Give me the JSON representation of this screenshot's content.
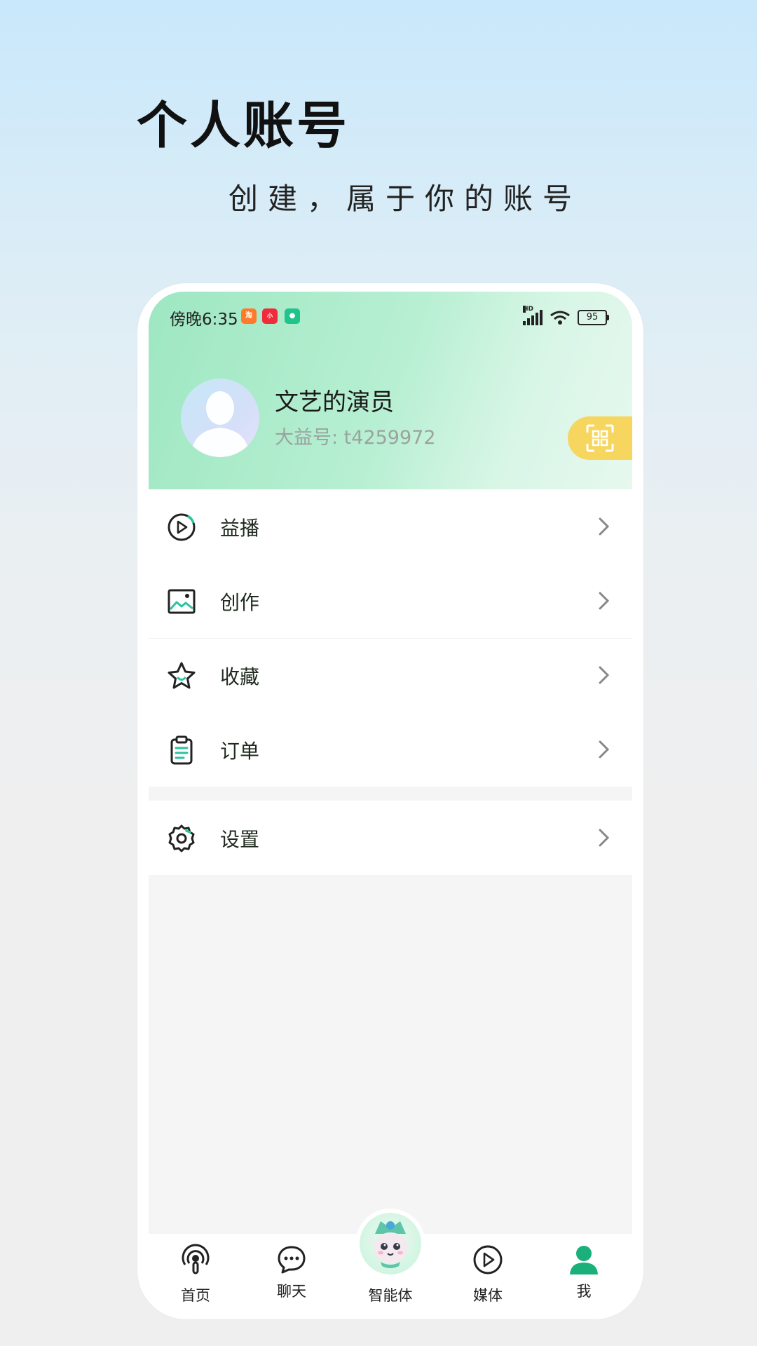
{
  "promo": {
    "title": "个人账号",
    "subtitle": "创建，属于你的账号"
  },
  "status_bar": {
    "time": "傍晚6:35",
    "network": "HD",
    "battery": "95"
  },
  "profile": {
    "name": "文艺的演员",
    "id_text": "大益号: t4259972"
  },
  "menu": {
    "items": [
      {
        "label": "益播",
        "icon": "play-circle-icon"
      },
      {
        "label": "创作",
        "icon": "image-icon"
      },
      {
        "label": "收藏",
        "icon": "star-icon"
      },
      {
        "label": "订单",
        "icon": "clipboard-icon"
      }
    ],
    "settings_label": "设置"
  },
  "bottom_nav": {
    "items": [
      {
        "label": "首页",
        "icon": "podcast-icon"
      },
      {
        "label": "聊天",
        "icon": "chat-bubble-icon"
      },
      {
        "label": "智能体",
        "icon": "mascot-icon"
      },
      {
        "label": "媒体",
        "icon": "play-icon"
      },
      {
        "label": "我",
        "icon": "person-icon",
        "active": true
      }
    ]
  },
  "colors": {
    "accent_green": "#1bb07a",
    "header_green": "#b7efd2",
    "qr_tab_yellow": "#f6d65e",
    "menu_icon_teal": "#2cc3a0"
  }
}
